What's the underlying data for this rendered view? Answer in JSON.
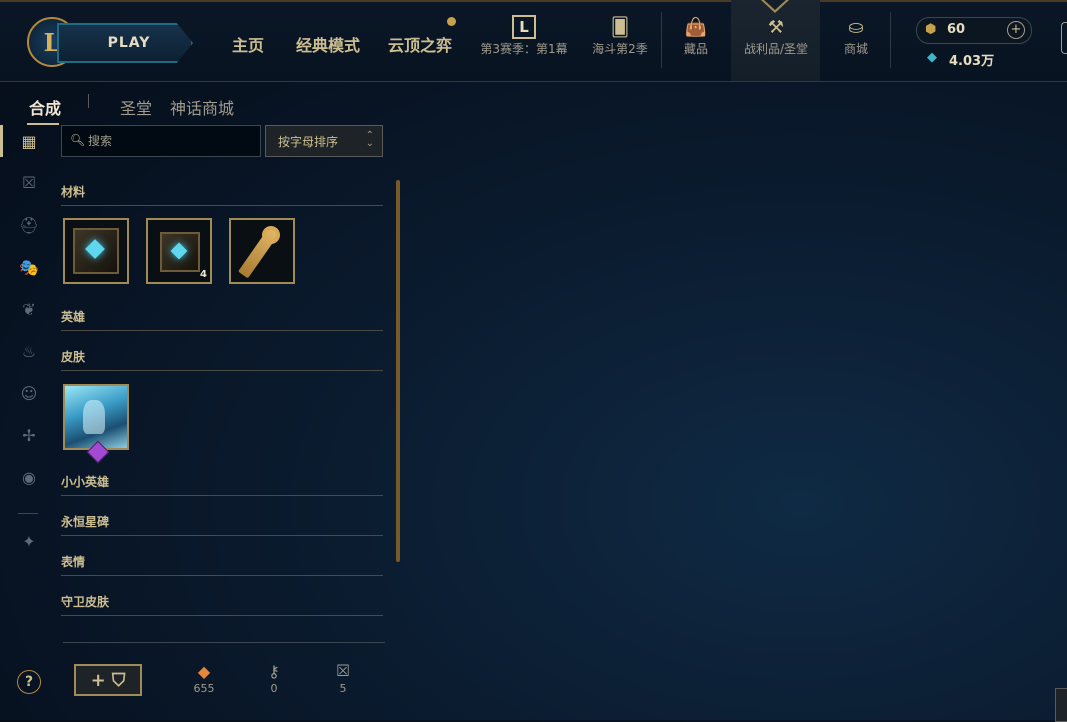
{
  "header": {
    "play_label": "PLAY",
    "nav_main": [
      "主页",
      "经典模式",
      "云顶之弈"
    ],
    "nav_icons": [
      {
        "label": "第3赛季：第1幕",
        "icon": "L"
      },
      {
        "label": "海斗第2季",
        "icon": "cards-icon"
      },
      {
        "label": "藏品",
        "icon": "bag-icon"
      },
      {
        "label": "战利品/圣堂",
        "icon": "loot-icon"
      },
      {
        "label": "商城",
        "icon": "store-icon"
      }
    ],
    "rp": "60",
    "be": "4.03万"
  },
  "subtabs": [
    "合成",
    "圣堂",
    "神话商城"
  ],
  "search": {
    "placeholder": "搜索"
  },
  "sort": {
    "label": "按字母排序"
  },
  "sections": [
    {
      "label": "材料"
    },
    {
      "label": "英雄"
    },
    {
      "label": "皮肤"
    },
    {
      "label": "小小英雄"
    },
    {
      "label": "永恒星碑"
    },
    {
      "label": "表情"
    },
    {
      "label": "守卫皮肤"
    }
  ],
  "materials": [
    {
      "name": "chest",
      "count": ""
    },
    {
      "name": "chest",
      "count": "4"
    },
    {
      "name": "key",
      "count": ""
    }
  ],
  "footer": {
    "craft_label": "+ ⛉",
    "stats": [
      {
        "icon": "orange-essence-icon",
        "value": "655"
      },
      {
        "icon": "key-fragment-icon",
        "value": "0"
      },
      {
        "icon": "chest-icon",
        "value": "5"
      }
    ]
  },
  "help_label": "?"
}
